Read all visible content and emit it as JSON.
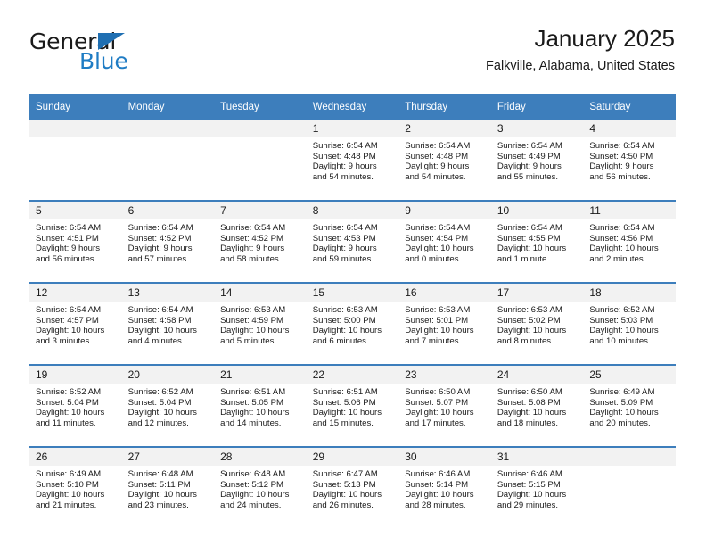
{
  "brand": {
    "name_top": "General",
    "name_bottom": "Blue",
    "triangle_color": "#1f6fb2",
    "blue_color": "#1f7cc4"
  },
  "header": {
    "title": "January 2025",
    "subtitle": "Falkville, Alabama, United States",
    "header_bg": "#3d7ebc",
    "daynum_bg": "#f2f2f2"
  },
  "weekday_headers": [
    "Sunday",
    "Monday",
    "Tuesday",
    "Wednesday",
    "Thursday",
    "Friday",
    "Saturday"
  ],
  "labels": {
    "sunrise_prefix": "Sunrise:",
    "sunset_prefix": "Sunset:",
    "daylight_prefix": "Daylight:"
  },
  "weeks": [
    [
      {
        "day": "",
        "empty": true
      },
      {
        "day": "",
        "empty": true
      },
      {
        "day": "",
        "empty": true
      },
      {
        "day": "1",
        "sunrise": "Sunrise: 6:54 AM",
        "sunset": "Sunset: 4:48 PM",
        "daylight": "Daylight: 9 hours and 54 minutes."
      },
      {
        "day": "2",
        "sunrise": "Sunrise: 6:54 AM",
        "sunset": "Sunset: 4:48 PM",
        "daylight": "Daylight: 9 hours and 54 minutes."
      },
      {
        "day": "3",
        "sunrise": "Sunrise: 6:54 AM",
        "sunset": "Sunset: 4:49 PM",
        "daylight": "Daylight: 9 hours and 55 minutes."
      },
      {
        "day": "4",
        "sunrise": "Sunrise: 6:54 AM",
        "sunset": "Sunset: 4:50 PM",
        "daylight": "Daylight: 9 hours and 56 minutes."
      }
    ],
    [
      {
        "day": "5",
        "sunrise": "Sunrise: 6:54 AM",
        "sunset": "Sunset: 4:51 PM",
        "daylight": "Daylight: 9 hours and 56 minutes."
      },
      {
        "day": "6",
        "sunrise": "Sunrise: 6:54 AM",
        "sunset": "Sunset: 4:52 PM",
        "daylight": "Daylight: 9 hours and 57 minutes."
      },
      {
        "day": "7",
        "sunrise": "Sunrise: 6:54 AM",
        "sunset": "Sunset: 4:52 PM",
        "daylight": "Daylight: 9 hours and 58 minutes."
      },
      {
        "day": "8",
        "sunrise": "Sunrise: 6:54 AM",
        "sunset": "Sunset: 4:53 PM",
        "daylight": "Daylight: 9 hours and 59 minutes."
      },
      {
        "day": "9",
        "sunrise": "Sunrise: 6:54 AM",
        "sunset": "Sunset: 4:54 PM",
        "daylight": "Daylight: 10 hours and 0 minutes."
      },
      {
        "day": "10",
        "sunrise": "Sunrise: 6:54 AM",
        "sunset": "Sunset: 4:55 PM",
        "daylight": "Daylight: 10 hours and 1 minute."
      },
      {
        "day": "11",
        "sunrise": "Sunrise: 6:54 AM",
        "sunset": "Sunset: 4:56 PM",
        "daylight": "Daylight: 10 hours and 2 minutes."
      }
    ],
    [
      {
        "day": "12",
        "sunrise": "Sunrise: 6:54 AM",
        "sunset": "Sunset: 4:57 PM",
        "daylight": "Daylight: 10 hours and 3 minutes."
      },
      {
        "day": "13",
        "sunrise": "Sunrise: 6:54 AM",
        "sunset": "Sunset: 4:58 PM",
        "daylight": "Daylight: 10 hours and 4 minutes."
      },
      {
        "day": "14",
        "sunrise": "Sunrise: 6:53 AM",
        "sunset": "Sunset: 4:59 PM",
        "daylight": "Daylight: 10 hours and 5 minutes."
      },
      {
        "day": "15",
        "sunrise": "Sunrise: 6:53 AM",
        "sunset": "Sunset: 5:00 PM",
        "daylight": "Daylight: 10 hours and 6 minutes."
      },
      {
        "day": "16",
        "sunrise": "Sunrise: 6:53 AM",
        "sunset": "Sunset: 5:01 PM",
        "daylight": "Daylight: 10 hours and 7 minutes."
      },
      {
        "day": "17",
        "sunrise": "Sunrise: 6:53 AM",
        "sunset": "Sunset: 5:02 PM",
        "daylight": "Daylight: 10 hours and 8 minutes."
      },
      {
        "day": "18",
        "sunrise": "Sunrise: 6:52 AM",
        "sunset": "Sunset: 5:03 PM",
        "daylight": "Daylight: 10 hours and 10 minutes."
      }
    ],
    [
      {
        "day": "19",
        "sunrise": "Sunrise: 6:52 AM",
        "sunset": "Sunset: 5:04 PM",
        "daylight": "Daylight: 10 hours and 11 minutes."
      },
      {
        "day": "20",
        "sunrise": "Sunrise: 6:52 AM",
        "sunset": "Sunset: 5:04 PM",
        "daylight": "Daylight: 10 hours and 12 minutes."
      },
      {
        "day": "21",
        "sunrise": "Sunrise: 6:51 AM",
        "sunset": "Sunset: 5:05 PM",
        "daylight": "Daylight: 10 hours and 14 minutes."
      },
      {
        "day": "22",
        "sunrise": "Sunrise: 6:51 AM",
        "sunset": "Sunset: 5:06 PM",
        "daylight": "Daylight: 10 hours and 15 minutes."
      },
      {
        "day": "23",
        "sunrise": "Sunrise: 6:50 AM",
        "sunset": "Sunset: 5:07 PM",
        "daylight": "Daylight: 10 hours and 17 minutes."
      },
      {
        "day": "24",
        "sunrise": "Sunrise: 6:50 AM",
        "sunset": "Sunset: 5:08 PM",
        "daylight": "Daylight: 10 hours and 18 minutes."
      },
      {
        "day": "25",
        "sunrise": "Sunrise: 6:49 AM",
        "sunset": "Sunset: 5:09 PM",
        "daylight": "Daylight: 10 hours and 20 minutes."
      }
    ],
    [
      {
        "day": "26",
        "sunrise": "Sunrise: 6:49 AM",
        "sunset": "Sunset: 5:10 PM",
        "daylight": "Daylight: 10 hours and 21 minutes."
      },
      {
        "day": "27",
        "sunrise": "Sunrise: 6:48 AM",
        "sunset": "Sunset: 5:11 PM",
        "daylight": "Daylight: 10 hours and 23 minutes."
      },
      {
        "day": "28",
        "sunrise": "Sunrise: 6:48 AM",
        "sunset": "Sunset: 5:12 PM",
        "daylight": "Daylight: 10 hours and 24 minutes."
      },
      {
        "day": "29",
        "sunrise": "Sunrise: 6:47 AM",
        "sunset": "Sunset: 5:13 PM",
        "daylight": "Daylight: 10 hours and 26 minutes."
      },
      {
        "day": "30",
        "sunrise": "Sunrise: 6:46 AM",
        "sunset": "Sunset: 5:14 PM",
        "daylight": "Daylight: 10 hours and 28 minutes."
      },
      {
        "day": "31",
        "sunrise": "Sunrise: 6:46 AM",
        "sunset": "Sunset: 5:15 PM",
        "daylight": "Daylight: 10 hours and 29 minutes."
      },
      {
        "day": "",
        "empty": true
      }
    ]
  ]
}
